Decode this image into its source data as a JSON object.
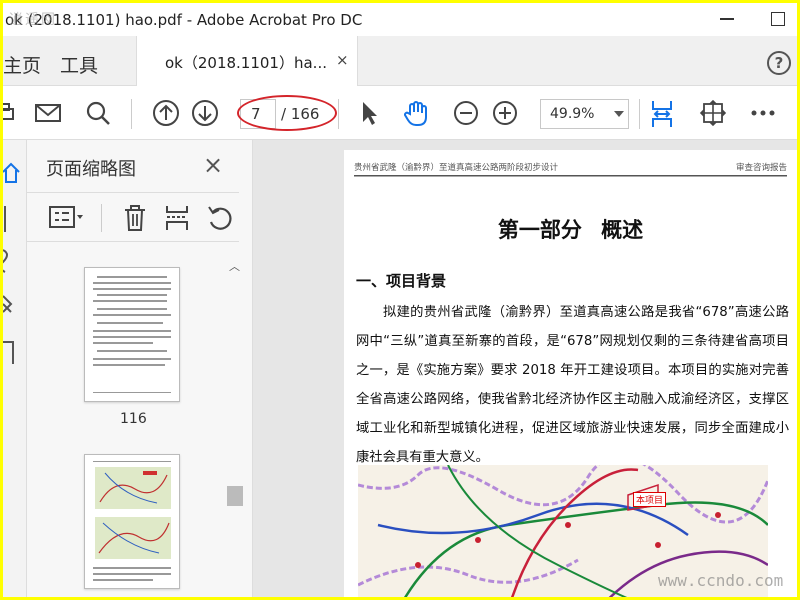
{
  "window": {
    "title": "ok (2018.1101)  hao.pdf - Adobe Acrobat Pro DC",
    "watermark_top_left": "逍遥网"
  },
  "tabs": {
    "home": "主页",
    "tools": "工具",
    "document": "ok（2018.1101）ha...",
    "close": "×"
  },
  "toolbar": {
    "current_page": "7",
    "total_pages": "/ 166",
    "zoom": "49.9%"
  },
  "thumbnails_pane": {
    "title": "页面缩略图",
    "close": "×",
    "thumbnail_page_label": "116"
  },
  "document": {
    "header_left": "贵州省武隆（渝黔界）至道真高速公路两阶段初步设计",
    "header_right": "审查咨询报告",
    "heading": "第一部分 概述",
    "section_title": "一、项目背景",
    "paragraph": "拟建的贵州省武隆（渝黔界）至道真高速公路是我省“678”高速公路网中“三纵”道真至新寨的首段，是“678”网规划仅剩的三条待建省高项目之一，是《实施方案》要求 2018 年开工建设项目。本项目的实施对完善全省高速公路网络，使我省黔北经济协作区主动融入成渝经济区，支撑区域工业化和新型城镇化进程，促进区域旅游业快速发展，同步全面建成小康社会具有重大意义。",
    "map_tag": "本项目"
  },
  "watermark_bottom_right": "www.ccndo.com",
  "colors": {
    "frame": "#ffff00",
    "annotation_ellipse": "#d4242a",
    "accent_blue": "#1473e6"
  }
}
